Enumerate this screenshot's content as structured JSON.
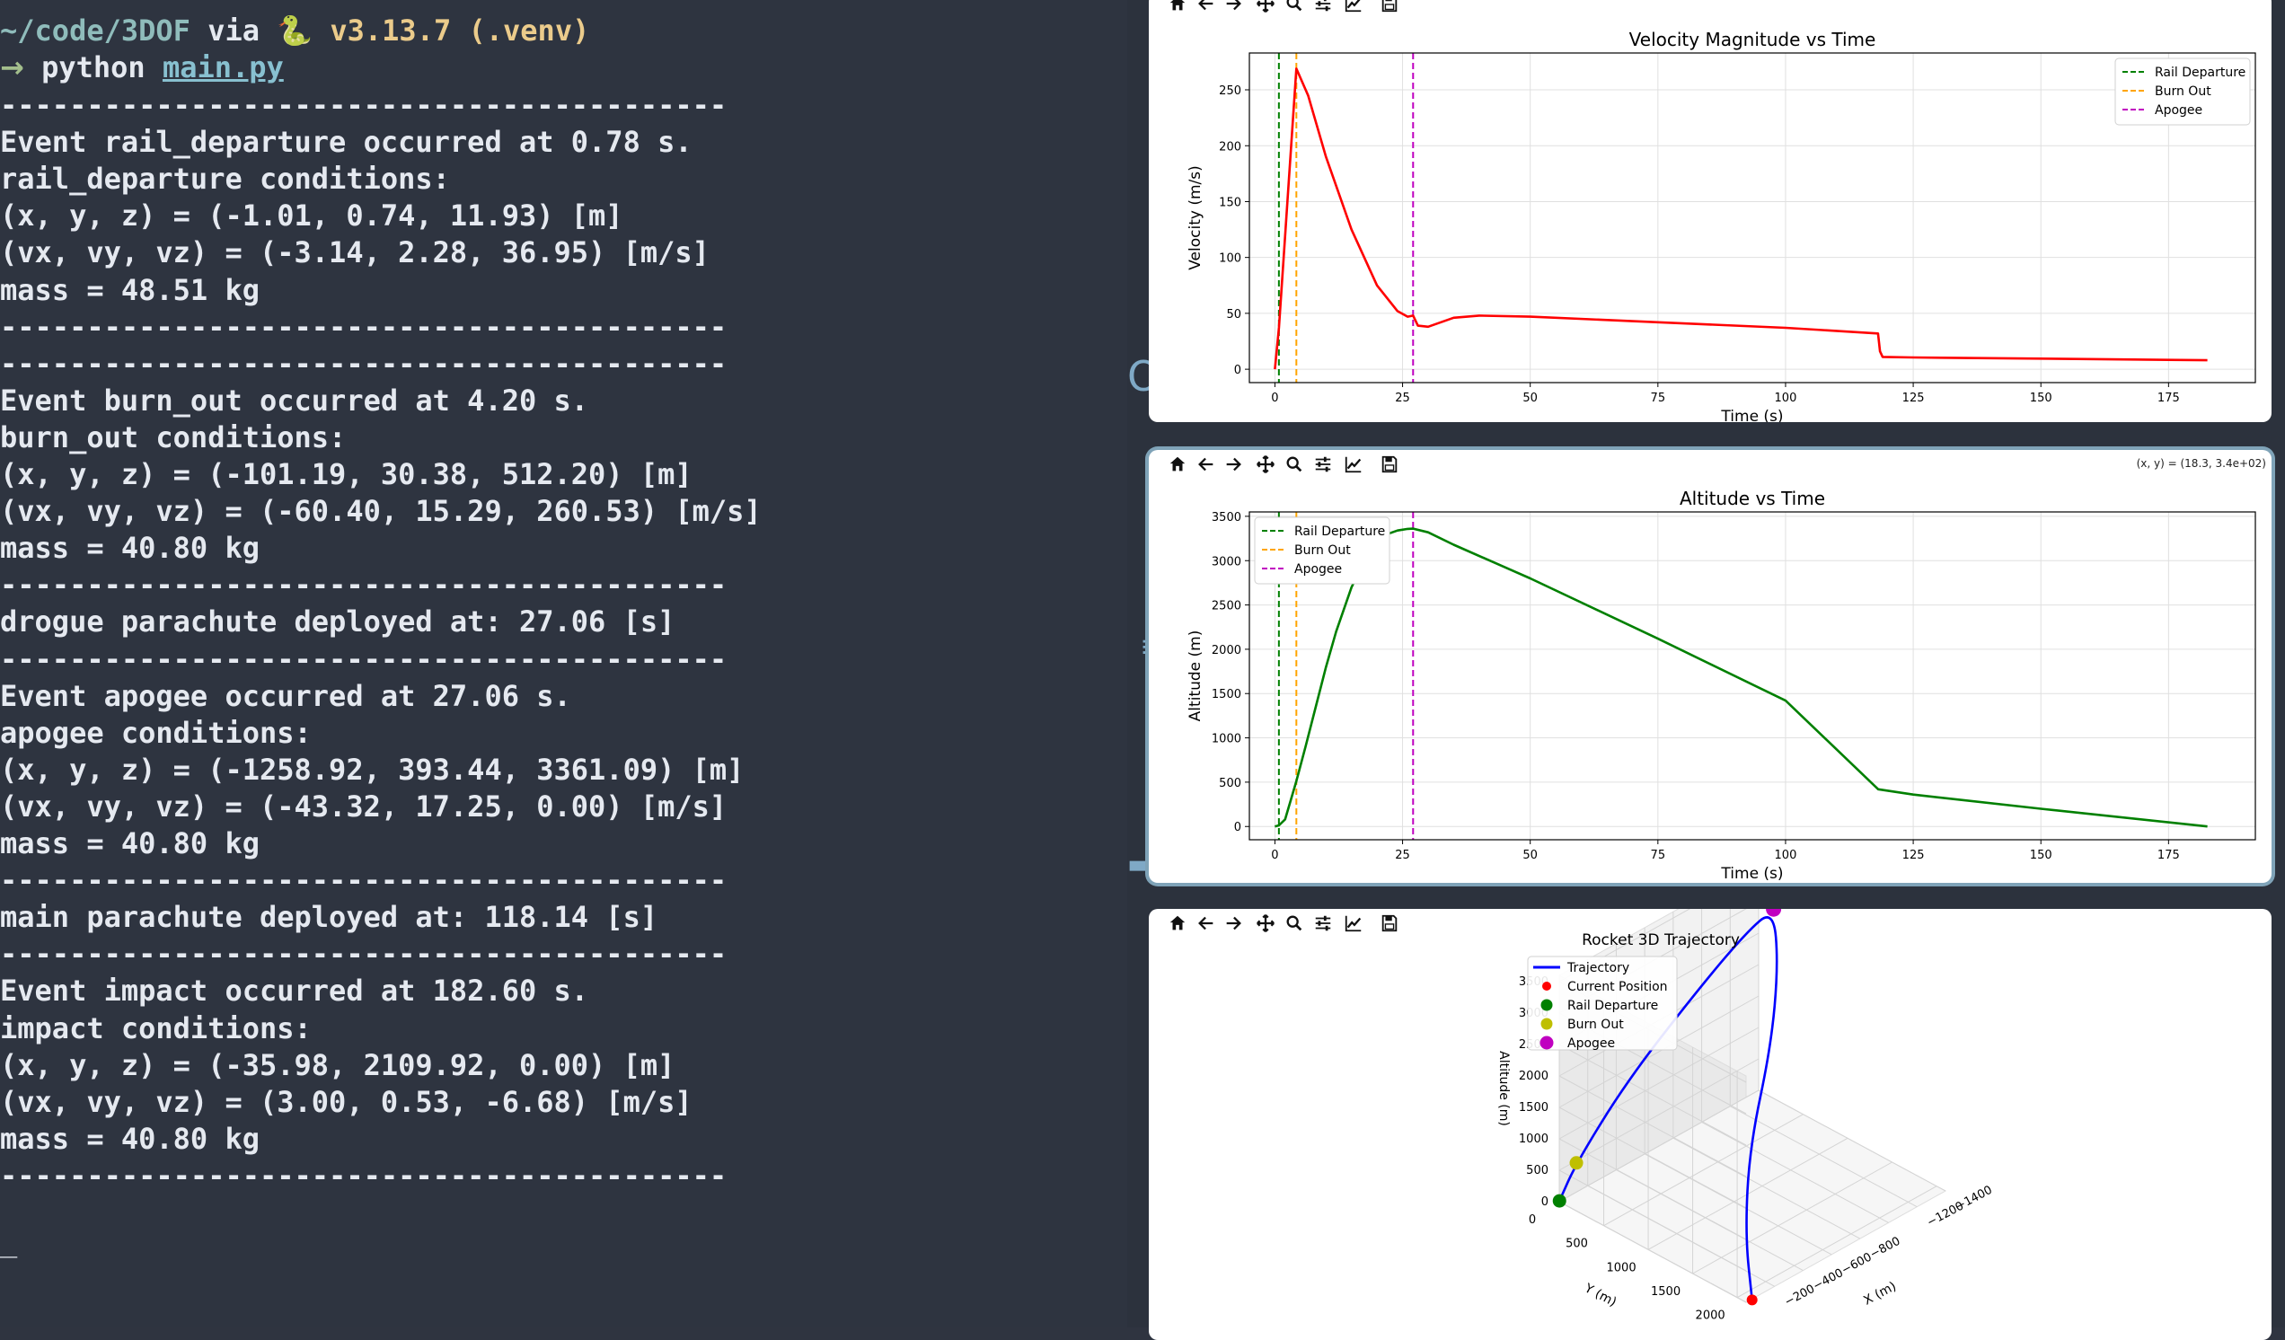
{
  "terminal": {
    "prompt_line": {
      "path": "~/code/3DOF",
      "via": " via ",
      "python_icon": "🐍",
      "python_version": "v3.13.7 (.venv)"
    },
    "command_line": {
      "arrow": "→",
      "command": " python ",
      "script_link": "main.py"
    },
    "lines": [
      "------------------------------------------",
      "Event rail_departure occurred at 0.78 s.",
      "rail_departure conditions:",
      "(x, y, z) = (-1.01, 0.74, 11.93) [m]",
      "(vx, vy, vz) = (-3.14, 2.28, 36.95) [m/s]",
      "mass = 48.51 kg",
      "------------------------------------------",
      "------------------------------------------",
      "Event burn_out occurred at 4.20 s.",
      "burn_out conditions:",
      "(x, y, z) = (-101.19, 30.38, 512.20) [m]",
      "(vx, vy, vz) = (-60.40, 15.29, 260.53) [m/s]",
      "mass = 40.80 kg",
      "------------------------------------------",
      "drogue parachute deployed at: 27.06 [s]",
      "------------------------------------------",
      "Event apogee occurred at 27.06 s.",
      "apogee conditions:",
      "(x, y, z) = (-1258.92, 393.44, 3361.09) [m]",
      "(vx, vy, vz) = (-43.32, 17.25, 0.00) [m/s]",
      "mass = 40.80 kg",
      "------------------------------------------",
      "main parachute deployed at: 118.14 [s]",
      "------------------------------------------",
      "Event impact occurred at 182.60 s.",
      "impact conditions:",
      "(x, y, z) = (-35.98, 2109.92, 0.00) [m]",
      "(vx, vy, vz) = (3.00, 0.53, -6.68) [m/s]",
      "mass = 40.80 kg",
      "------------------------------------------"
    ],
    "cursor": "_"
  },
  "toolbar_icons": [
    "home-icon",
    "back-arrow-icon",
    "forward-arrow-icon",
    "pan-icon",
    "zoom-icon",
    "configure-subplots-icon",
    "edit-axis-icon",
    "save-icon"
  ],
  "figure2": {
    "coord_readout": "(x, y) = (18.3, 3.4e+02)"
  },
  "colors": {
    "rail_departure": "#008000",
    "burn_out": "#ffa500",
    "apogee": "#c000c0",
    "velocity_line": "#ff0000",
    "altitude_line": "#008000",
    "trajectory_line": "#0000ff"
  },
  "chart_data": [
    {
      "type": "line",
      "title": "Velocity Magnitude vs Time",
      "xlabel": "Time (s)",
      "ylabel": "Velocity (m/s)",
      "xlim": [
        -5,
        192
      ],
      "ylim": [
        -12,
        283
      ],
      "xticks": [
        0,
        25,
        50,
        75,
        100,
        125,
        150,
        175
      ],
      "yticks": [
        0,
        50,
        100,
        150,
        200,
        250
      ],
      "grid": true,
      "legend_position": "top-right",
      "series": [
        {
          "name": "",
          "color": "#ff0000",
          "x": [
            0,
            0.78,
            4.2,
            6.5,
            10,
            15,
            20,
            24,
            26,
            27.06,
            28,
            30,
            35,
            40,
            50,
            75,
            100,
            118.1,
            118.5,
            119,
            125,
            150,
            182.6
          ],
          "y": [
            0,
            37,
            269,
            245,
            190,
            125,
            75,
            52,
            47,
            48,
            39,
            38,
            46,
            48,
            47,
            42,
            37,
            32,
            16,
            11,
            10.5,
            9.5,
            8
          ]
        }
      ],
      "vlines": [
        {
          "name": "Rail Departure",
          "x": 0.78,
          "style": "dashed",
          "color": "#008000"
        },
        {
          "name": "Burn Out",
          "x": 4.2,
          "style": "dashed",
          "color": "#ffa500"
        },
        {
          "name": "Apogee",
          "x": 27.06,
          "style": "dashed",
          "color": "#c000c0"
        }
      ]
    },
    {
      "type": "line",
      "title": "Altitude vs Time",
      "xlabel": "Time (s)",
      "ylabel": "Altitude (m)",
      "xlim": [
        -5,
        192
      ],
      "ylim": [
        -150,
        3550
      ],
      "xticks": [
        0,
        25,
        50,
        75,
        100,
        125,
        150,
        175
      ],
      "yticks": [
        0,
        500,
        1000,
        1500,
        2000,
        2500,
        3000,
        3500
      ],
      "grid": true,
      "legend_position": "top-left",
      "series": [
        {
          "name": "",
          "color": "#008000",
          "x": [
            0,
            0.78,
            2,
            4.2,
            6,
            8,
            10,
            12,
            15,
            18,
            20,
            22,
            24,
            26,
            27.06,
            30,
            35,
            50,
            75,
            100,
            118.14,
            125,
            150,
            182.6
          ],
          "y": [
            0,
            12,
            80,
            512,
            900,
            1350,
            1800,
            2200,
            2700,
            3050,
            3200,
            3300,
            3340,
            3358,
            3361,
            3320,
            3180,
            2800,
            2120,
            1420,
            420,
            360,
            200,
            0
          ]
        }
      ],
      "vlines": [
        {
          "name": "Rail Departure",
          "x": 0.78,
          "style": "dashed",
          "color": "#008000"
        },
        {
          "name": "Burn Out",
          "x": 4.2,
          "style": "dashed",
          "color": "#ffa500"
        },
        {
          "name": "Apogee",
          "x": 27.06,
          "style": "dashed",
          "color": "#c000c0"
        }
      ]
    },
    {
      "type": "line",
      "title": "Rocket 3D Trajectory",
      "xlabel": "X (m)",
      "ylabel": "Y (m)",
      "zlabel": "Altitude (m)",
      "xticks": [
        -200,
        -400,
        -600,
        -800,
        -1200,
        -1400
      ],
      "yticks": [
        0,
        500,
        1000,
        1500,
        2000
      ],
      "zticks": [
        0,
        500,
        1000,
        1500,
        2000,
        2500,
        3000,
        3500
      ],
      "legend_position": "top-left",
      "series": [
        {
          "name": "Trajectory",
          "color": "#0000ff",
          "x": [
            -1.01,
            -101.19,
            -400,
            -800,
            -1100,
            -1258.92,
            -1100,
            -800,
            -400,
            -150,
            -35.98
          ],
          "y": [
            0.74,
            30.38,
            120,
            250,
            340,
            393.44,
            700,
            1100,
            1500,
            1850,
            2109.92
          ],
          "z": [
            11.93,
            512.2,
            1500,
            2500,
            3150,
            3361.09,
            2900,
            2300,
            1500,
            700,
            0
          ]
        }
      ],
      "points": [
        {
          "name": "Current Position",
          "color": "#ff0000",
          "x": -35.98,
          "y": 2109.92,
          "z": 0
        },
        {
          "name": "Rail Departure",
          "color": "#008000",
          "x": -1.01,
          "y": 0.74,
          "z": 11.93
        },
        {
          "name": "Burn Out",
          "color": "#bfbf00",
          "x": -101.19,
          "y": 30.38,
          "z": 512.2
        },
        {
          "name": "Apogee",
          "color": "#c000c0",
          "x": -1258.92,
          "y": 393.44,
          "z": 3361.09
        }
      ]
    }
  ]
}
